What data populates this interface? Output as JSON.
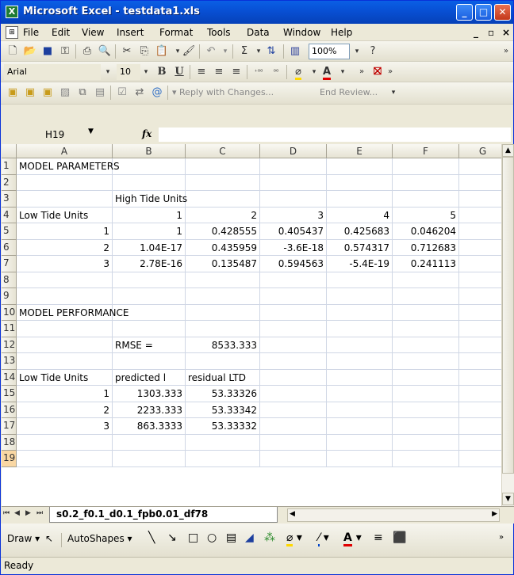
{
  "window": {
    "title": "Microsoft Excel - testdata1.xls",
    "min": "_",
    "max": "□",
    "close": "✕"
  },
  "menu": [
    "File",
    "Edit",
    "View",
    "Insert",
    "Format",
    "Tools",
    "Data",
    "Window",
    "Help"
  ],
  "menu_right": {
    "min": "_",
    "restore": "▫",
    "close": "×"
  },
  "toolbar1": {
    "zoom": "100%"
  },
  "toolbar2": {
    "font": "Arial",
    "size": "10",
    "bold": "B",
    "underline": "U"
  },
  "toolbar3": {
    "reply": "Reply with Changes...",
    "end_review": "End Review..."
  },
  "formula_bar": {
    "namebox": "H19",
    "fx": "fx"
  },
  "columns": [
    "A",
    "B",
    "C",
    "D",
    "E",
    "F",
    "G"
  ],
  "rows": [
    "1",
    "2",
    "3",
    "4",
    "5",
    "6",
    "7",
    "8",
    "9",
    "10",
    "11",
    "12",
    "13",
    "14",
    "15",
    "16",
    "17",
    "18",
    "19"
  ],
  "cells": {
    "r1a": "MODEL PARAMETERS",
    "r3b": "High Tide Units",
    "r4a": "Low Tide Units",
    "r4b": "1",
    "r4c": "2",
    "r4d": "3",
    "r4e": "4",
    "r4f": "5",
    "r5b": "1",
    "r5a": "1",
    "r5c": "0.428555",
    "r5d": "0.405437",
    "r5e": "0.425683",
    "r5f": "0.046204",
    "r6a": "2",
    "r6b": "1.04E-17",
    "r6c": "0.435959",
    "r6d": "-3.6E-18",
    "r6e": "0.574317",
    "r6f": "0.712683",
    "r7a": "3",
    "r7b": "2.78E-16",
    "r7c": "0.135487",
    "r7d": "0.594563",
    "r7e": "-5.4E-19",
    "r7f": "0.241113",
    "r10a": "MODEL PERFORMANCE",
    "r12b": "RMSE =",
    "r12c": "8533.333",
    "r14a": "Low Tide Units",
    "r14b": "predicted l",
    "r14c": "residual LTD",
    "r15a": "1",
    "r15b": "1303.333",
    "r15c": "53.33326",
    "r16a": "2",
    "r16b": "2233.333",
    "r16c": "53.33342",
    "r17a": "3",
    "r17b": "863.3333",
    "r17c": "53.33332"
  },
  "sheet_tab": "s0.2_f0.1_d0.1_fpb0.01_df78",
  "drawing": {
    "draw": "Draw",
    "autoshapes": "AutoShapes"
  },
  "status": "Ready"
}
